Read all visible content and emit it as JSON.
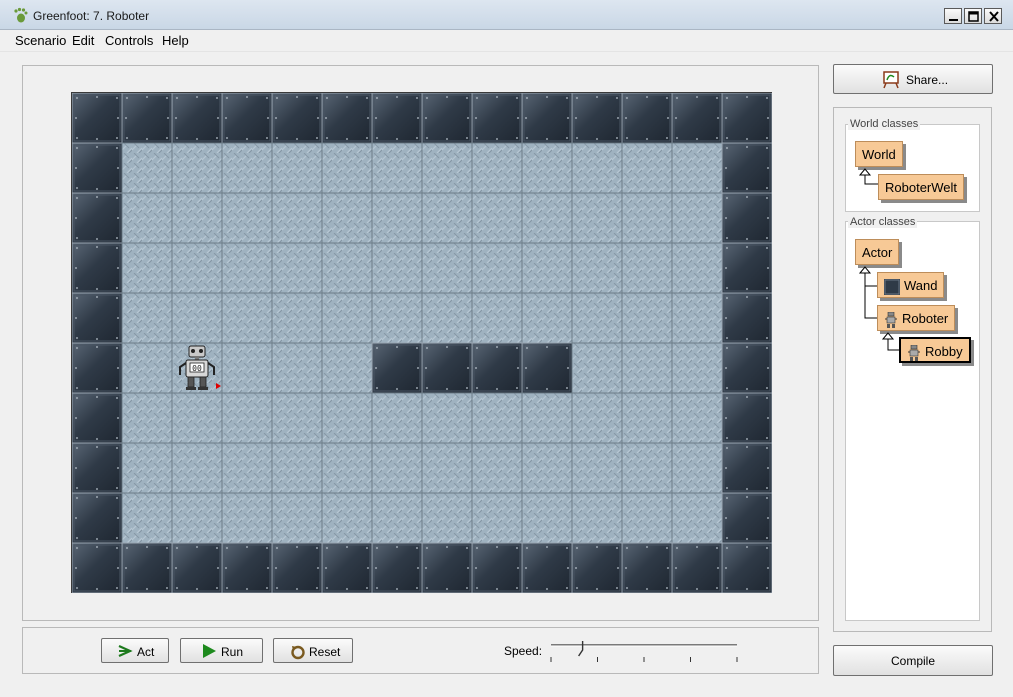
{
  "window": {
    "title": "Greenfoot: 7. Roboter",
    "app_icon": "greenfoot-icon",
    "controls": [
      "minimize-icon",
      "maximize-icon",
      "close-icon"
    ]
  },
  "menubar": {
    "items": [
      "Scenario",
      "Edit",
      "Controls",
      "Help"
    ]
  },
  "world": {
    "columns": 14,
    "rows": 10,
    "wall_tiles": [
      [
        6,
        5
      ],
      [
        7,
        5
      ],
      [
        8,
        5
      ],
      [
        9,
        5
      ]
    ],
    "robot": {
      "col": 2,
      "row": 5,
      "icon": "robot-icon",
      "facing": "east"
    },
    "colors": {
      "floor": "#9fb2c0",
      "wall": "#2e3946",
      "grid": "#6c7c88"
    }
  },
  "controls": {
    "act_label": "Act",
    "run_label": "Run",
    "reset_label": "Reset",
    "speed_label": "Speed:",
    "speed_value": 0.17
  },
  "sidebar": {
    "share_label": "Share...",
    "world_classes_title": "World classes",
    "world_classes": [
      "World",
      "RoboterWelt"
    ],
    "actor_classes_title": "Actor classes",
    "actor_classes": [
      "Actor",
      "Wand",
      "Roboter",
      "Robby"
    ],
    "selected_class": "Robby",
    "class_color": "#f7c996",
    "compile_label": "Compile"
  }
}
